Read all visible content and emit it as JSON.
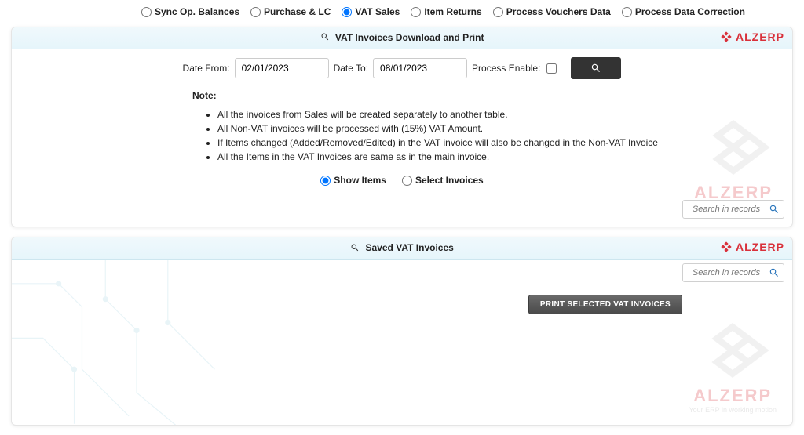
{
  "top_radios": {
    "sync": "Sync Op. Balances",
    "purchase": "Purchase & LC",
    "vat_sales": "VAT Sales",
    "item_returns": "Item Returns",
    "vouchers": "Process Vouchers Data",
    "correction": "Process Data Correction"
  },
  "panel1": {
    "title": "VAT Invoices Download and Print",
    "brand": "ALZERP",
    "filters": {
      "date_from_label": "Date From:",
      "date_from_value": "02/01/2023",
      "date_to_label": "Date To:",
      "date_to_value": "08/01/2023",
      "process_enable_label": "Process Enable:"
    },
    "notes_heading": "Note:",
    "notes": [
      "All the invoices from Sales will be created separately to another table.",
      "All Non-VAT invoices will be processed with (15%) VAT Amount.",
      "If Items changed (Added/Removed/Edited) in the VAT invoice will also be changed in the Non-VAT Invoice",
      "All the Items in the VAT Invoices are same as in the main invoice."
    ],
    "display_options": {
      "show_items": "Show Items",
      "select_invoices": "Select Invoices"
    },
    "search_placeholder": "Search in records"
  },
  "panel2": {
    "title": "Saved VAT Invoices",
    "brand": "ALZERP",
    "search_placeholder": "Search in records",
    "print_button": "PRINT SELECTED VAT INVOICES",
    "wm_sub": "Your ERP in working motion"
  }
}
